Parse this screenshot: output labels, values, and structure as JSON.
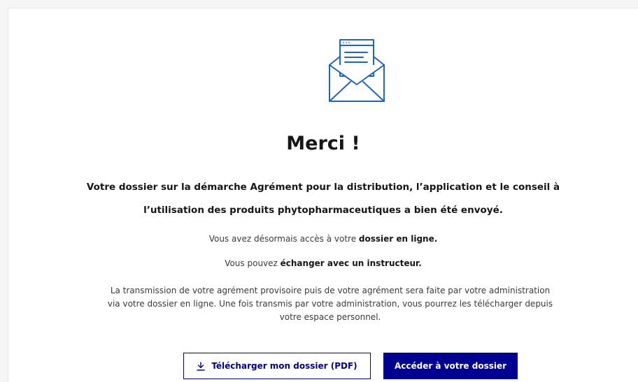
{
  "confirmation": {
    "icon": "mail-envelope-icon",
    "title": "Merci !",
    "lead_line1": "Votre dossier sur la démarche Agrément pour la distribution, l’application et le conseil à",
    "lead_line2": "l’utilisation des produits phytopharmaceutiques a bien été envoyé.",
    "p1_prefix": "Vous avez désormais accès à votre ",
    "p1_bold": "dossier en ligne.",
    "p2_prefix": "Vous pouvez ",
    "p2_bold": "échanger avec un instructeur.",
    "p3": "La transmission de votre agrément provisoire puis de votre agrément sera faite par votre administration via votre dossier en ligne. Une fois transmis par votre administration, vous pourrez les télécharger depuis votre espace personnel."
  },
  "actions": {
    "download_label": "Télécharger mon dossier (PDF)",
    "download_icon": "download-icon",
    "access_label": "Accéder à votre dossier"
  },
  "colors": {
    "primary": "#000091",
    "icon_blue": "#1d63c8"
  }
}
